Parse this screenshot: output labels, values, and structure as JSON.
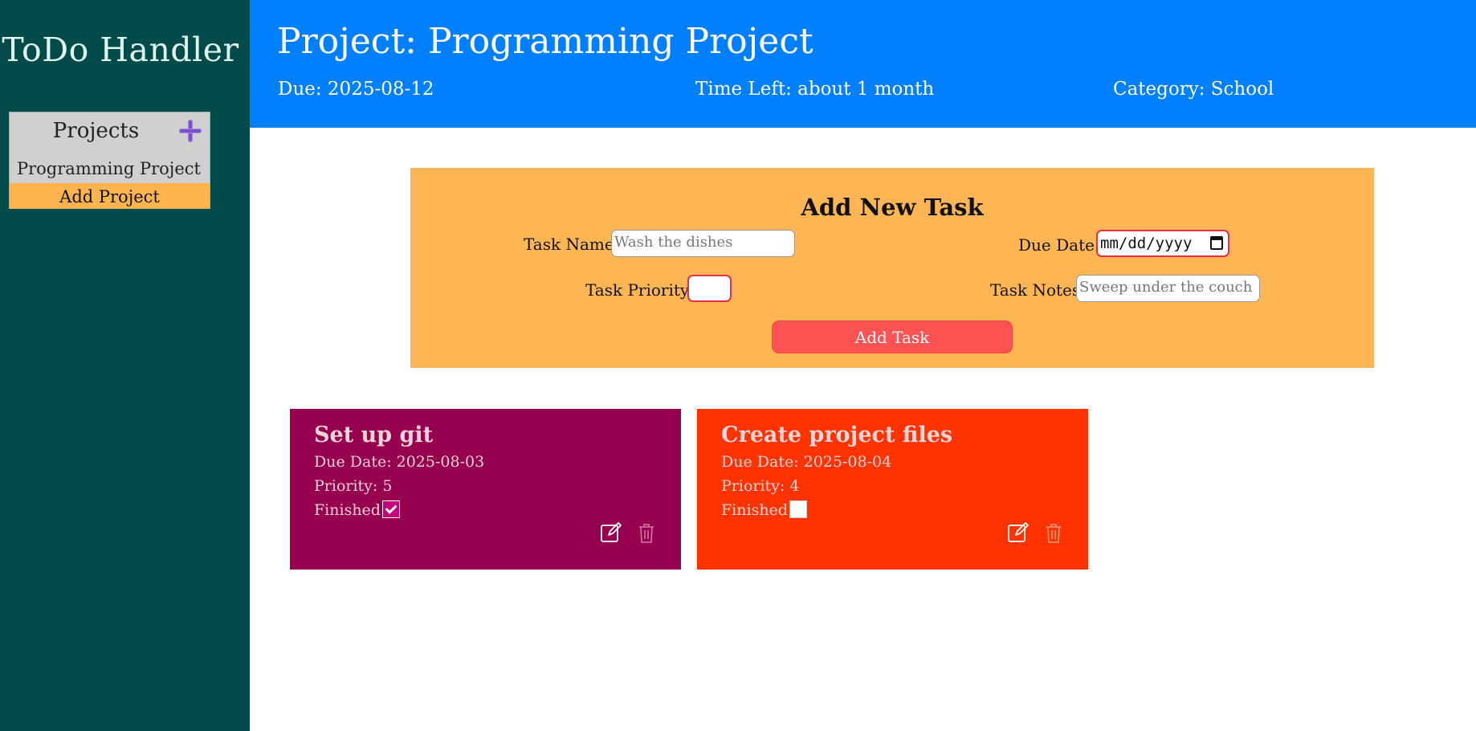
{
  "sidebar": {
    "app_title": "ToDo Handler",
    "projects_header": "Projects",
    "add_icon": "plus-icon",
    "projects": [
      "Programming Project"
    ],
    "add_project_label": "Add Project"
  },
  "header": {
    "title": "Project: Programming Project",
    "due": "Due: 2025-08-12",
    "time_left": "Time Left: about 1 month",
    "category": "Category: School"
  },
  "form": {
    "title": "Add New Task",
    "task_name_label": "Task Name:",
    "task_name_placeholder": "Wash the dishes",
    "due_date_label": "Due Date:",
    "due_date_placeholder": "mm/dd/yyyy",
    "priority_label": "Task Priority:",
    "priority_value": "",
    "notes_label": "Task Notes:",
    "notes_placeholder": "Sweep under the couch",
    "submit_label": "Add Task"
  },
  "tasks": [
    {
      "title": "Set up git",
      "due": "Due Date: 2025-08-03",
      "priority": "Priority: 5",
      "finished_label": "Finished",
      "finished": true,
      "color": "#97004e"
    },
    {
      "title": "Create project files",
      "due": "Due Date: 2025-08-04",
      "priority": "Priority: 4",
      "finished_label": "Finished",
      "finished": false,
      "color": "#ff3300"
    }
  ],
  "colors": {
    "sidebar": "#034b4b",
    "header": "#0080ff",
    "form": "#fdb653",
    "button": "#ff5252",
    "add_project": "#fdb44f"
  }
}
